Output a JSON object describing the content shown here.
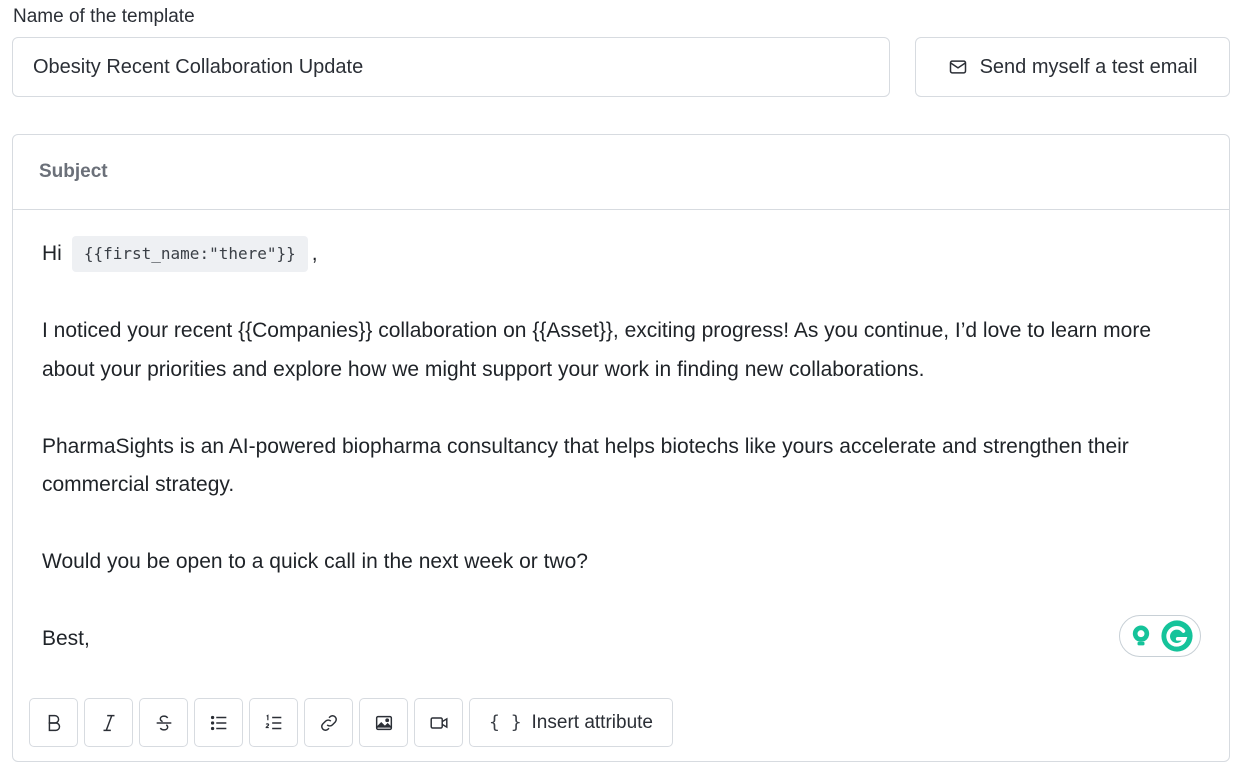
{
  "template": {
    "name_label": "Name of the template",
    "name_value": "Obesity Recent Collaboration Update"
  },
  "actions": {
    "test_email_label": "Send myself a test email",
    "test_email_icon": "mail-icon"
  },
  "editor": {
    "subject_placeholder": "Subject",
    "subject_value": "",
    "greeting_prefix": "Hi",
    "greeting_attribute": "{{first_name:\"there\"}}",
    "greeting_suffix": ",",
    "paragraphs": [
      "I noticed your recent {{Companies}} collaboration on {{Asset}}, exciting progress! As you continue, I’d love to learn more about your priorities and explore how we might support your work in finding new collaborations.",
      "PharmaSights is an AI-powered biopharma consultancy that helps biotechs like yours accelerate and strengthen their commercial strategy.",
      "Would you be open to a quick call in the next week or two?",
      "Best,"
    ]
  },
  "toolbar": {
    "buttons": [
      {
        "name": "bold",
        "icon": "bold-icon"
      },
      {
        "name": "italic",
        "icon": "italic-icon"
      },
      {
        "name": "strikethrough",
        "icon": "strikethrough-icon"
      },
      {
        "name": "bullet-list",
        "icon": "bullet-list-icon"
      },
      {
        "name": "numbered-list",
        "icon": "numbered-list-icon"
      },
      {
        "name": "link",
        "icon": "link-icon"
      },
      {
        "name": "image",
        "icon": "image-icon"
      },
      {
        "name": "video",
        "icon": "video-icon"
      }
    ],
    "insert_attribute_label": "Insert attribute",
    "insert_attribute_icon": "braces-icon"
  },
  "colors": {
    "grammarly_green": "#15c39a",
    "grammarly_dark": "#0e7a63",
    "border": "#d7dbe0"
  }
}
